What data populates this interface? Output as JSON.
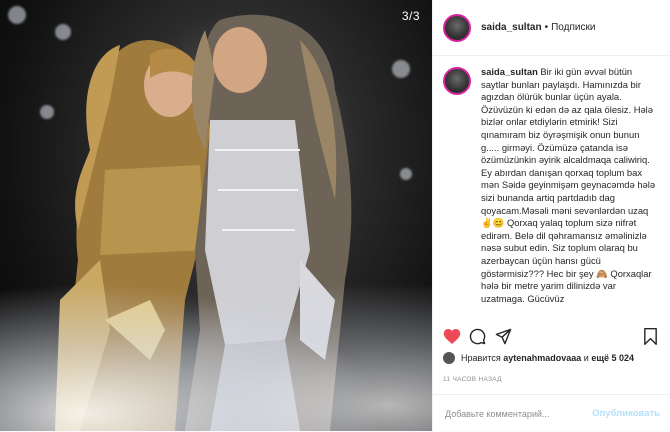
{
  "photo": {
    "counter": "3/3"
  },
  "header": {
    "username": "saida_sultan",
    "separator": "•",
    "follow_label": "Подписки"
  },
  "caption": {
    "username": "saida_sultan",
    "text": "Bir iki gün əvvəl bütün saytlar bunları paylaşdı. Hamınızda bir agızdan ölürük bunlar üçün ayala. Özüvüzün ki edən də az qala ölesiz. Hələ bizlər onlar etdiylərin etmirik! Sizi qınamıram biz öyrəşmişik onun bunun g..... girməyi. Özümüzə çatanda isə özümüzünkin əyirik alcaldmaqa caliwiriq. Ey abırdan danışan qorxaq toplum bax mən Səidə geyinmişəm geynacəmdə hələ sizi bunanda artiq partdadıb dag qoyacam.Məsəli məni sevənlərdən uzaq✌️😊 Qorxaq yalaq toplum sizə nifrət edirəm. Belə dil qəhramansız əməlinizlə nəsə subut edin. Siz toplum olaraq bu azerbaycan üçün hansı gücü göstərmisiz??? Hec bir şey 🙈 Qorxaqlar hələ bir metre yarim dilinizdə var uzatmaga. Gücüvüz"
  },
  "actions": {
    "like": "heart-icon",
    "comment": "comment-icon",
    "share": "share-icon",
    "save": "bookmark-icon"
  },
  "likes": {
    "prefix": "Нравится",
    "user": "aytenahmadovaaa",
    "middle": "и",
    "others": "ещё 5 024"
  },
  "timestamp": "11 ЧАСОВ НАЗАД",
  "add_comment": {
    "placeholder": "Добавьте комментарий...",
    "publish_label": "Опубликовать"
  },
  "colors": {
    "like_red": "#ed4956",
    "text": "#262626",
    "muted": "#8e8e8e",
    "publish_disabled": "#b2dffc"
  }
}
